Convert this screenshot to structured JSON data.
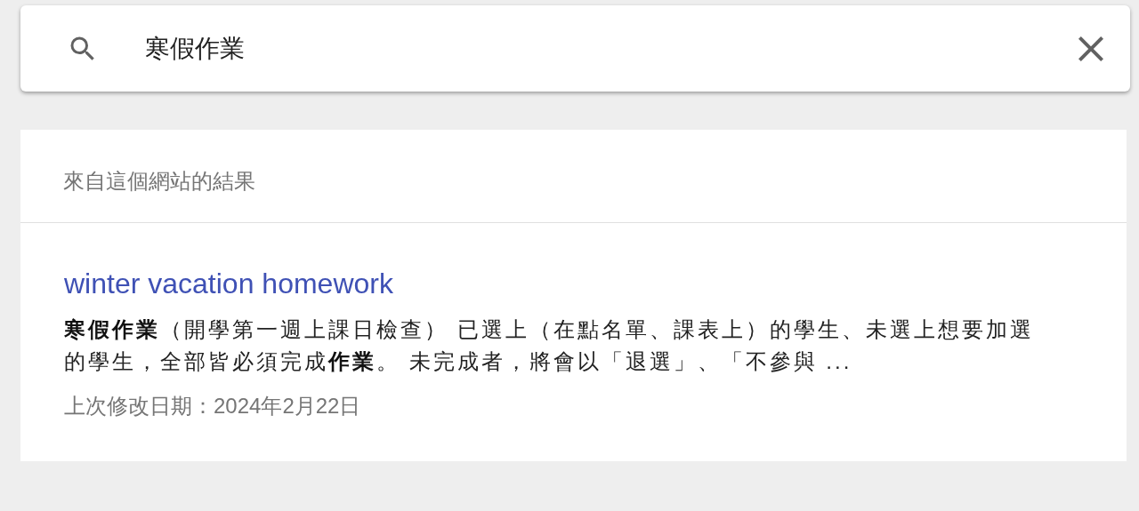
{
  "search": {
    "value": "寒假作業"
  },
  "results": {
    "heading": "來自這個網站的結果",
    "items": [
      {
        "title": "winter vacation homework",
        "snippet": "**寒假作業**（開學第一週上課日檢查） 已選上（在點名單、課表上）的學生、未選上想要加選的學生，全部皆必須完成**作業**。 未完成者，將會以「退選」、「不參與 ...",
        "date": "上次修改日期：2024年2月22日"
      }
    ]
  }
}
